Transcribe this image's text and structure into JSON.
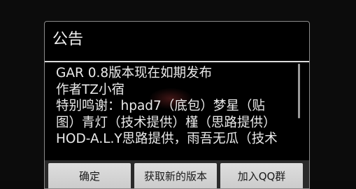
{
  "dialog": {
    "title": "公告",
    "content_lines": [
      "GAR 0.8版本现在如期发布",
      "作者TZ小宿",
      "特别鸣谢：hpad7（底包）梦星（贴",
      "图）青灯（技术提供）槿（思路提供）",
      "HOD-A.L.Y思路提供，雨吾无瓜（技术"
    ],
    "buttons": {
      "ok": "确定",
      "get_new_version": "获取新的版本",
      "join_qq_group": "加入QQ群"
    }
  }
}
